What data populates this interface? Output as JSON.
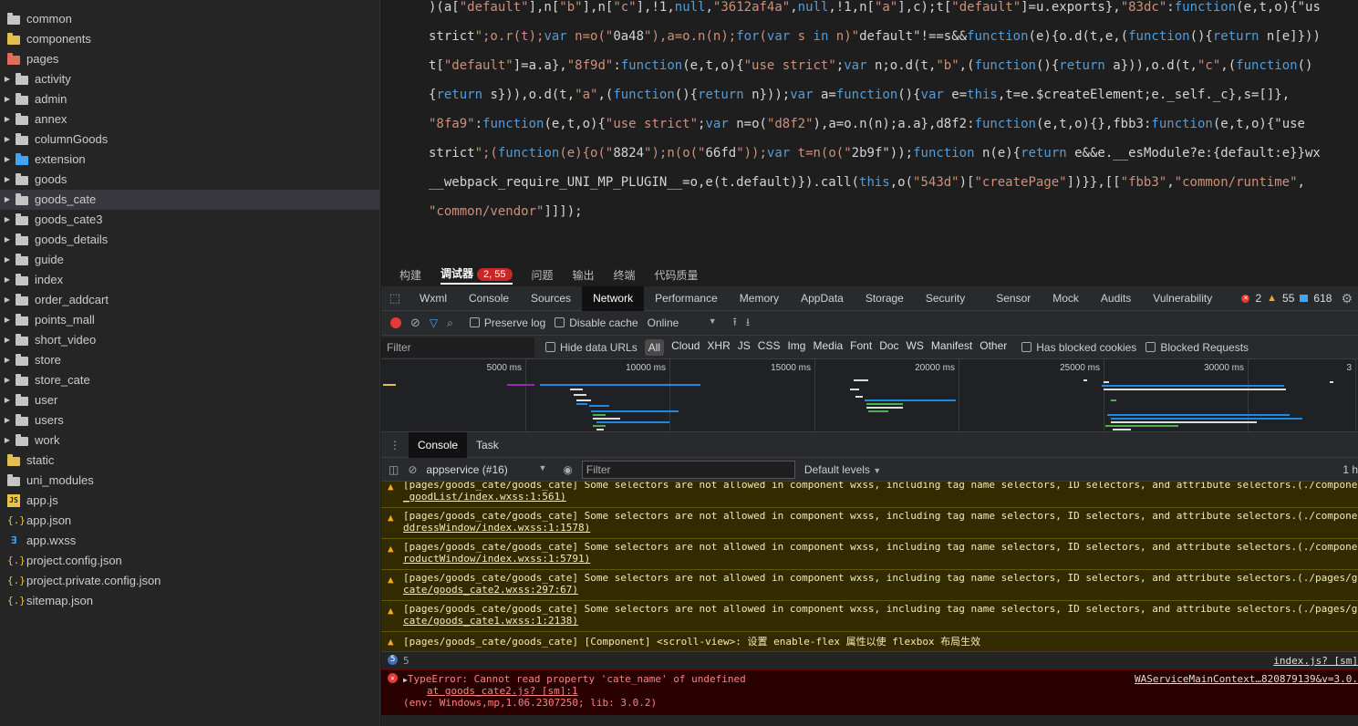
{
  "sidebar": {
    "items": [
      {
        "label": "common",
        "icon": "folder-icon",
        "color": "#c5c5c5",
        "caret": false,
        "indent": 0
      },
      {
        "label": "components",
        "icon": "folder-icon",
        "color": "#e2c04f",
        "caret": false,
        "indent": 0
      },
      {
        "label": "pages",
        "icon": "folder-icon",
        "color": "#e06c5b",
        "caret": false,
        "indent": 0
      },
      {
        "label": "activity",
        "icon": "folder-icon",
        "color": "#c5c5c5",
        "caret": true,
        "indent": 1
      },
      {
        "label": "admin",
        "icon": "folder-icon",
        "color": "#c5c5c5",
        "caret": true,
        "indent": 1
      },
      {
        "label": "annex",
        "icon": "folder-icon",
        "color": "#c5c5c5",
        "caret": true,
        "indent": 1
      },
      {
        "label": "columnGoods",
        "icon": "folder-icon",
        "color": "#c5c5c5",
        "caret": true,
        "indent": 1
      },
      {
        "label": "extension",
        "icon": "folder-icon",
        "color": "#42a5f5",
        "caret": true,
        "indent": 1
      },
      {
        "label": "goods",
        "icon": "folder-icon",
        "color": "#c5c5c5",
        "caret": true,
        "indent": 1
      },
      {
        "label": "goods_cate",
        "icon": "folder-icon",
        "color": "#c5c5c5",
        "caret": true,
        "indent": 1,
        "selected": true
      },
      {
        "label": "goods_cate3",
        "icon": "folder-icon",
        "color": "#c5c5c5",
        "caret": true,
        "indent": 1
      },
      {
        "label": "goods_details",
        "icon": "folder-icon",
        "color": "#c5c5c5",
        "caret": true,
        "indent": 1
      },
      {
        "label": "guide",
        "icon": "folder-icon",
        "color": "#c5c5c5",
        "caret": true,
        "indent": 1
      },
      {
        "label": "index",
        "icon": "folder-icon",
        "color": "#c5c5c5",
        "caret": true,
        "indent": 1
      },
      {
        "label": "order_addcart",
        "icon": "folder-icon",
        "color": "#c5c5c5",
        "caret": true,
        "indent": 1
      },
      {
        "label": "points_mall",
        "icon": "folder-icon",
        "color": "#c5c5c5",
        "caret": true,
        "indent": 1
      },
      {
        "label": "short_video",
        "icon": "folder-icon",
        "color": "#c5c5c5",
        "caret": true,
        "indent": 1
      },
      {
        "label": "store",
        "icon": "folder-icon",
        "color": "#c5c5c5",
        "caret": true,
        "indent": 1
      },
      {
        "label": "store_cate",
        "icon": "folder-icon",
        "color": "#c5c5c5",
        "caret": true,
        "indent": 1
      },
      {
        "label": "user",
        "icon": "folder-icon",
        "color": "#c5c5c5",
        "caret": true,
        "indent": 1
      },
      {
        "label": "users",
        "icon": "folder-icon",
        "color": "#c5c5c5",
        "caret": true,
        "indent": 1
      },
      {
        "label": "work",
        "icon": "folder-icon",
        "color": "#c5c5c5",
        "caret": true,
        "indent": 1
      },
      {
        "label": "static",
        "icon": "folder-icon",
        "color": "#e2c04f",
        "caret": false,
        "indent": 0
      },
      {
        "label": "uni_modules",
        "icon": "folder-icon",
        "color": "#c5c5c5",
        "caret": false,
        "indent": 0
      },
      {
        "label": "app.js",
        "icon": "js-file-icon",
        "caret": false,
        "indent": 0
      },
      {
        "label": "app.json",
        "icon": "json-file-icon",
        "caret": false,
        "indent": 0
      },
      {
        "label": "app.wxss",
        "icon": "wxss-file-icon",
        "caret": false,
        "indent": 0
      },
      {
        "label": "project.config.json",
        "icon": "json-file-icon",
        "caret": false,
        "indent": 0
      },
      {
        "label": "project.private.config.json",
        "icon": "json-file-icon",
        "caret": false,
        "indent": 0
      },
      {
        "label": "sitemap.json",
        "icon": "json-file-icon",
        "caret": false,
        "indent": 0
      }
    ]
  },
  "editor": {
    "lines": [
      ")(a[\"default\"],n[\"b\"],n[\"c\"],!1,null,\"3612af4a\",null,!1,n[\"a\"],c);t[\"default\"]=u.exports},\"83dc\":function(e,t,o){\"us",
      "strict\";o.r(t);var n=o(\"0a48\"),a=o.n(n);for(var s in n)\"default\"!==s&&function(e){o.d(t,e,(function(){return n[e]}))",
      "t[\"default\"]=a.a},\"8f9d\":function(e,t,o){\"use strict\";var n;o.d(t,\"b\",(function(){return a})),o.d(t,\"c\",(function()",
      "{return s})),o.d(t,\"a\",(function(){return n}));var a=function(){var e=this,t=e.$createElement;e._self._c},s=[]},",
      "\"8fa9\":function(e,t,o){\"use strict\";var n=o(\"d8f2\"),a=o.n(n);a.a},d8f2:function(e,t,o){},fbb3:function(e,t,o){\"use",
      "strict\";(function(e){o(\"8824\");n(o(\"66fd\"));var t=n(o(\"2b9f\"));function n(e){return e&&e.__esModule?e:{default:e}}wx",
      "__webpack_require_UNI_MP_PLUGIN__=o,e(t.default)}).call(this,o(\"543d\")[\"createPage\"])}},[[\"fbb3\",\"common/runtime\",",
      "\"common/vendor\"]]]);"
    ]
  },
  "panel_tabs": [
    {
      "label": "构建",
      "active": false
    },
    {
      "label": "调试器",
      "active": true,
      "badge": "2, 55"
    },
    {
      "label": "问题",
      "active": false
    },
    {
      "label": "输出",
      "active": false
    },
    {
      "label": "终端",
      "active": false
    },
    {
      "label": "代码质量",
      "active": false
    }
  ],
  "devtools": {
    "tabs": [
      "Wxml",
      "Console",
      "Sources",
      "Network",
      "Performance",
      "Memory",
      "AppData",
      "Storage",
      "Security",
      "Sensor",
      "Mock",
      "Audits",
      "Vulnerability"
    ],
    "active_tab": "Network",
    "counts": {
      "errors": "2",
      "warnings": "55",
      "info": "618"
    }
  },
  "network": {
    "preserve_log": "Preserve log",
    "disable_cache": "Disable cache",
    "throttle": "Online",
    "filter_placeholder": "Filter",
    "hide_data_urls": "Hide data URLs",
    "types": [
      "All",
      "Cloud",
      "XHR",
      "JS",
      "CSS",
      "Img",
      "Media",
      "Font",
      "Doc",
      "WS",
      "Manifest",
      "Other"
    ],
    "has_blocked_cookies": "Has blocked cookies",
    "blocked_requests": "Blocked Requests",
    "timeline_ticks": [
      "5000 ms",
      "10000 ms",
      "15000 ms",
      "20000 ms",
      "25000 ms",
      "30000 ms",
      "3"
    ]
  },
  "drawer": {
    "tabs": [
      "Console",
      "Task"
    ],
    "active": "Console"
  },
  "console": {
    "context": "appservice (#16)",
    "filter_placeholder": "Filter",
    "levels": "Default levels",
    "right_text": "1 h",
    "messages": [
      {
        "type": "warn",
        "line1": "[pages/goods_cate/goods_cate] Some selectors are not allowed in component wxss, including tag name selectors, ID selectors, and attribute selectors.(./componer",
        "line2": "_goodList/index.wxss:1:561)"
      },
      {
        "type": "warn",
        "line1": "[pages/goods_cate/goods_cate] Some selectors are not allowed in component wxss, including tag name selectors, ID selectors, and attribute selectors.(./componer",
        "line2": "ddressWindow/index.wxss:1:1578)"
      },
      {
        "type": "warn",
        "line1": "[pages/goods_cate/goods_cate] Some selectors are not allowed in component wxss, including tag name selectors, ID selectors, and attribute selectors.(./componer",
        "line2": "roductWindow/index.wxss:1:5791)"
      },
      {
        "type": "warn",
        "line1": "[pages/goods_cate/goods_cate] Some selectors are not allowed in component wxss, including tag name selectors, ID selectors, and attribute selectors.(./pages/go",
        "line2": "cate/goods_cate2.wxss:297:67)"
      },
      {
        "type": "warn",
        "line1": "[pages/goods_cate/goods_cate] Some selectors are not allowed in component wxss, including tag name selectors, ID selectors, and attribute selectors.(./pages/go",
        "line2": "cate/goods_cate1.wxss:1:2138)"
      },
      {
        "type": "warn",
        "line1": "[pages/goods_cate/goods_cate] [Component] <scroll-view>: 设置 enable-flex 属性以使 flexbox 布局生效",
        "line2": ""
      }
    ],
    "group": {
      "count": "5",
      "label": "5",
      "source": "index.js? [sm]"
    },
    "error": {
      "line1": "TypeError: Cannot read property 'cate_name' of undefined",
      "line2": "at goods_cate2.js? [sm]:1",
      "line3": "(env: Windows,mp,1.06.2307250; lib: 3.0.2)",
      "source": "WAServiceMainContext…820879139&v=3.0."
    },
    "prompt": "›"
  }
}
